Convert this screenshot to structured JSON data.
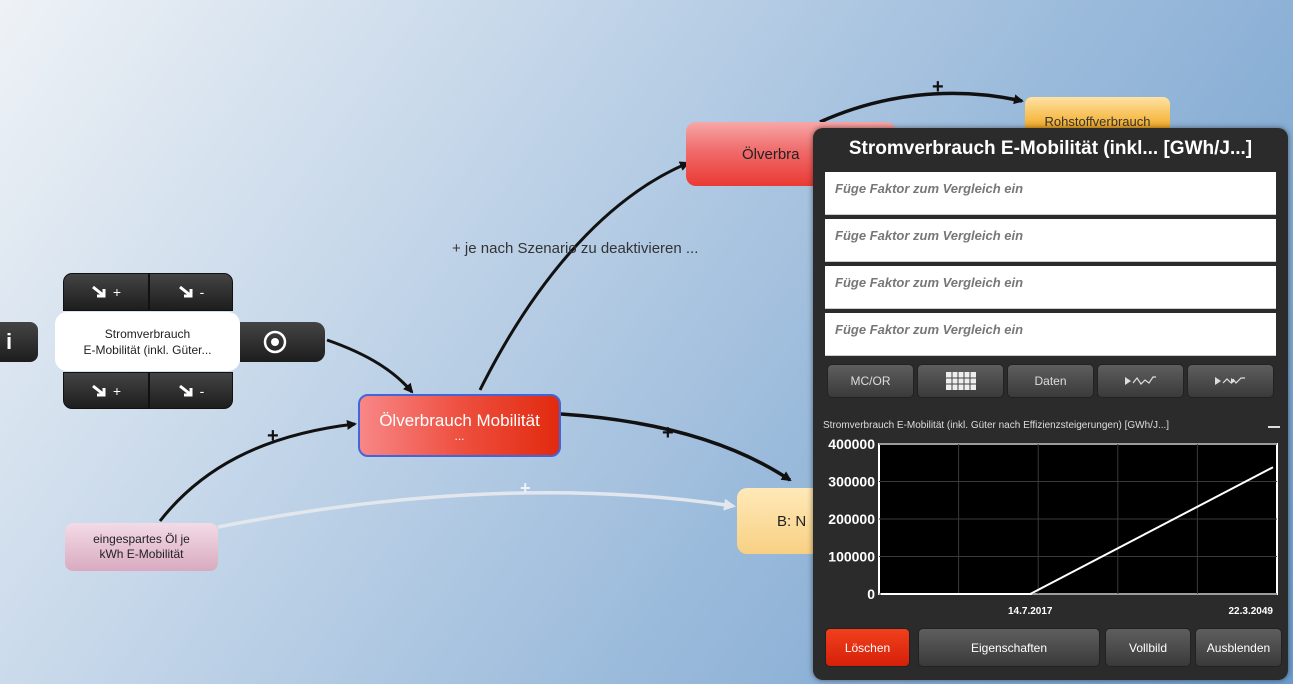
{
  "canvas": {
    "edge_label_scenario": "+ je nach Szenario zu deaktivieren ...",
    "plus": "+"
  },
  "nodes": {
    "main": {
      "label": "Ölverbrauch Mobilität",
      "dots": "..."
    },
    "oelverbr": {
      "label": "Ölverbra"
    },
    "rohstoff": {
      "label": "Rohstoffverbrauch"
    },
    "b": {
      "label": "B: N"
    },
    "oel": {
      "line1": "eingespartes Öl je",
      "line2": "kWh E-Mobilität"
    },
    "strom": {
      "line1": "Stromverbrauch",
      "line2": "E-Mobilität (inkl. Güter..."
    }
  },
  "node_controls": {
    "left_info": "i",
    "top_plus": "+",
    "top_minus": "-",
    "bottom_plus": "+",
    "bottom_minus": "-"
  },
  "panel": {
    "title": "Stromverbrauch E-Mobilität (inkl... [GWh/J...]",
    "compare_placeholders": [
      "Füge Faktor zum Vergleich ein",
      "Füge Faktor zum Vergleich ein",
      "Füge Faktor zum Vergleich ein",
      "Füge Faktor zum Vergleich ein"
    ],
    "tools": {
      "mcor": "MC/OR",
      "daten": "Daten"
    },
    "series_label": "Stromverbrauch E-Mobilität (inkl. Güter nach Effizienzsteigerungen) [GWh/J...]",
    "buttons": {
      "delete": "Löschen",
      "properties": "Eigenschaften",
      "fullscreen": "Vollbild",
      "hide": "Ausblenden"
    }
  },
  "chart_data": {
    "type": "line",
    "x_tick_labels": [
      "14.7.2017",
      "22.3.2049"
    ],
    "y_ticks": [
      0,
      100000,
      200000,
      300000,
      400000
    ],
    "y_tick_labels": [
      "0",
      "100000",
      "200000",
      "300000",
      "400000"
    ],
    "ylim": [
      0,
      400000
    ],
    "x": [
      "2000",
      "14.7.2017",
      "22.3.2049"
    ],
    "values": [
      0,
      0,
      338000
    ],
    "grid": true,
    "line_color": "#ffffff",
    "background": "#000000"
  },
  "colors": {
    "delete_red": "#e22a0f",
    "selection_blue": "#4266d8"
  }
}
